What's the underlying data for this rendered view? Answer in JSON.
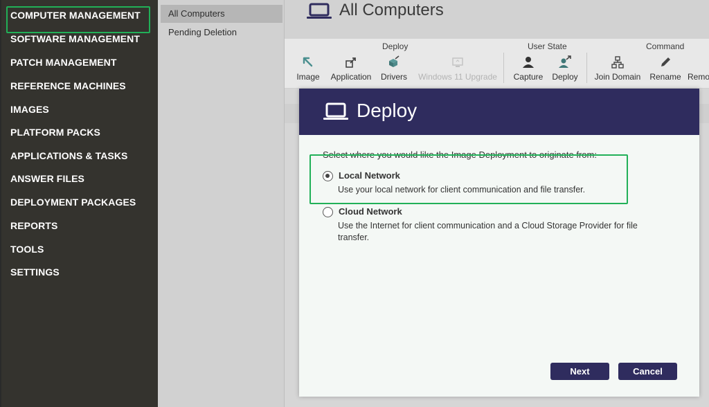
{
  "nav": {
    "items": [
      {
        "label": "COMPUTER MANAGEMENT"
      },
      {
        "label": "SOFTWARE MANAGEMENT"
      },
      {
        "label": "PATCH MANAGEMENT"
      },
      {
        "label": "REFERENCE MACHINES"
      },
      {
        "label": "IMAGES"
      },
      {
        "label": "PLATFORM PACKS"
      },
      {
        "label": "APPLICATIONS & TASKS"
      },
      {
        "label": "ANSWER FILES"
      },
      {
        "label": "DEPLOYMENT PACKAGES"
      },
      {
        "label": "REPORTS"
      },
      {
        "label": "TOOLS"
      },
      {
        "label": "SETTINGS"
      }
    ]
  },
  "list": {
    "items": [
      {
        "label": "All Computers"
      },
      {
        "label": "Pending Deletion"
      }
    ]
  },
  "page": {
    "title": "All Computers"
  },
  "ribbon": {
    "groups": {
      "deploy": "Deploy",
      "user_state": "User State",
      "command": "Command"
    },
    "buttons": {
      "image": "Image",
      "application": "Application",
      "drivers": "Drivers",
      "win11": "Windows 11 Upgrade",
      "capture": "Capture",
      "deploy": "Deploy",
      "join_domain": "Join Domain",
      "rename": "Rename",
      "remove": "Remo"
    }
  },
  "modal": {
    "title": "Deploy",
    "prompt": "Select where you would like the Image Deployment to originate from:",
    "options": [
      {
        "title": "Local Network",
        "desc": "Use your local network for client communication and file transfer.",
        "selected": true
      },
      {
        "title": "Cloud Network",
        "desc": "Use the Internet for client communication and a Cloud Storage Provider for file transfer.",
        "selected": false
      }
    ],
    "buttons": {
      "next": "Next",
      "cancel": "Cancel"
    }
  },
  "colors": {
    "nav_bg": "#34332e",
    "modal_header": "#2f2c5e",
    "highlight": "#21b058",
    "button_bg": "#2f2c5e"
  },
  "icons": {
    "title": "laptop-icon",
    "modal": "laptop-icon",
    "image": "arrow-up-left-icon",
    "application": "application-deploy-icon",
    "drivers": "drivers-icon",
    "win11": "windows-upgrade-icon",
    "capture": "user-icon",
    "deploy": "user-deploy-icon",
    "join_domain": "network-icon",
    "rename": "pencil-icon"
  }
}
